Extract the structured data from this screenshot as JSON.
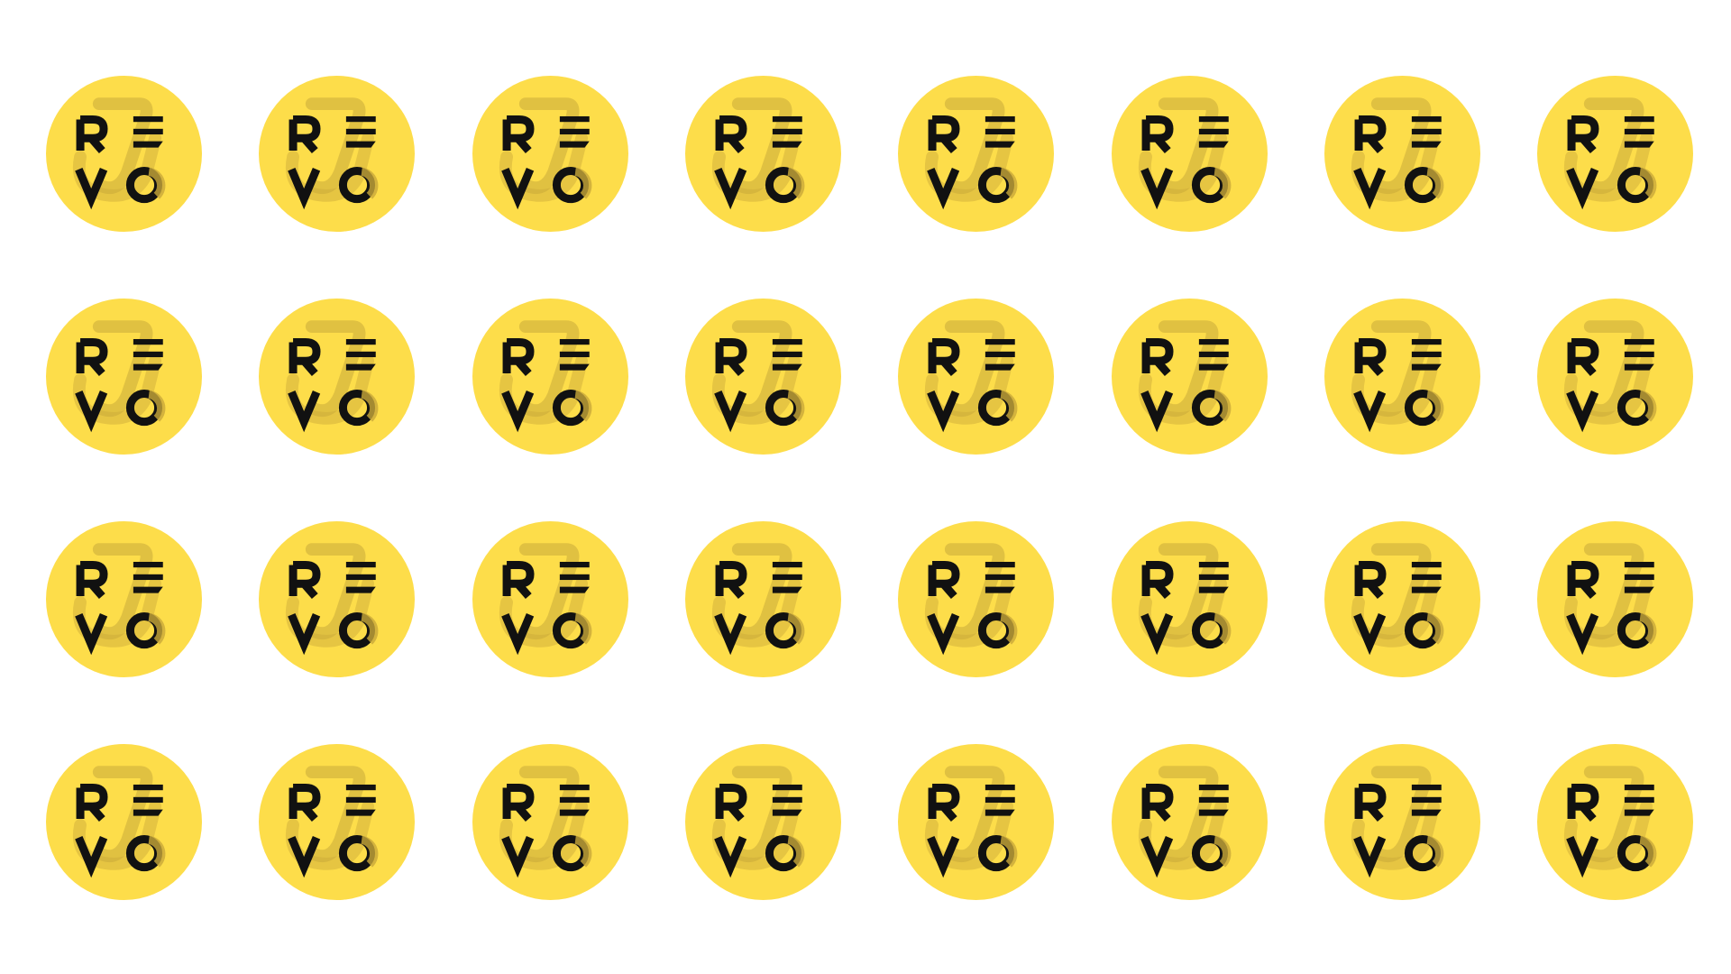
{
  "logo": {
    "text": "REVO",
    "icon": "revo-logo-icon",
    "colors": {
      "badge": "#FDDD4A",
      "mark": "#111111",
      "shadow_stroke": "#C9A93A"
    }
  },
  "grid": {
    "rows": 4,
    "columns": 8,
    "count": 32
  }
}
